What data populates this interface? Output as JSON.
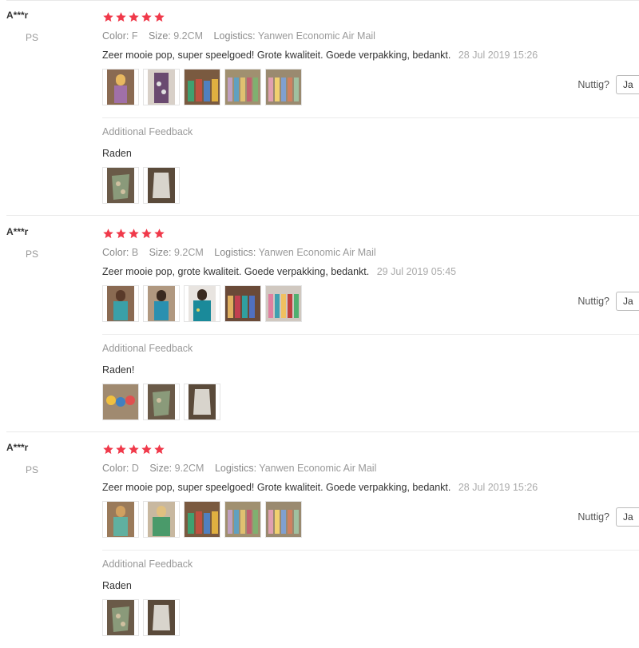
{
  "reviews": [
    {
      "user": "A***r",
      "country": "PS",
      "rating": 5,
      "labels": {
        "color": "Color:",
        "size": "Size:",
        "logistics": "Logistics:"
      },
      "color": "F",
      "size": "9.2CM",
      "logistics": "Yanwen Economic Air Mail",
      "comment": "Zeer mooie pop, super speelgoed! Grote kwaliteit. Goede verpakking, bedankt.",
      "date": "28 Jul 2019 15:26",
      "helpful_label": "Nuttig?",
      "helpful_button": "Ja",
      "additional_title": "Additional Feedback",
      "additional_comment": "Raden"
    },
    {
      "user": "A***r",
      "country": "PS",
      "rating": 5,
      "labels": {
        "color": "Color:",
        "size": "Size:",
        "logistics": "Logistics:"
      },
      "color": "B",
      "size": "9.2CM",
      "logistics": "Yanwen Economic Air Mail",
      "comment": "Zeer mooie pop, grote kwaliteit. Goede verpakking, bedankt.",
      "date": "29 Jul 2019 05:45",
      "helpful_label": "Nuttig?",
      "helpful_button": "Ja",
      "additional_title": "Additional Feedback",
      "additional_comment": "Raden!"
    },
    {
      "user": "A***r",
      "country": "PS",
      "rating": 5,
      "labels": {
        "color": "Color:",
        "size": "Size:",
        "logistics": "Logistics:"
      },
      "color": "D",
      "size": "9.2CM",
      "logistics": "Yanwen Economic Air Mail",
      "comment": "Zeer mooie pop, super speelgoed! Grote kwaliteit. Goede verpakking, bedankt.",
      "date": "28 Jul 2019 15:26",
      "helpful_label": "Nuttig?",
      "helpful_button": "Ja",
      "additional_title": "Additional Feedback",
      "additional_comment": "Raden"
    }
  ],
  "colors": {
    "star": "#f0394a",
    "muted": "#999999",
    "text": "#333333"
  }
}
